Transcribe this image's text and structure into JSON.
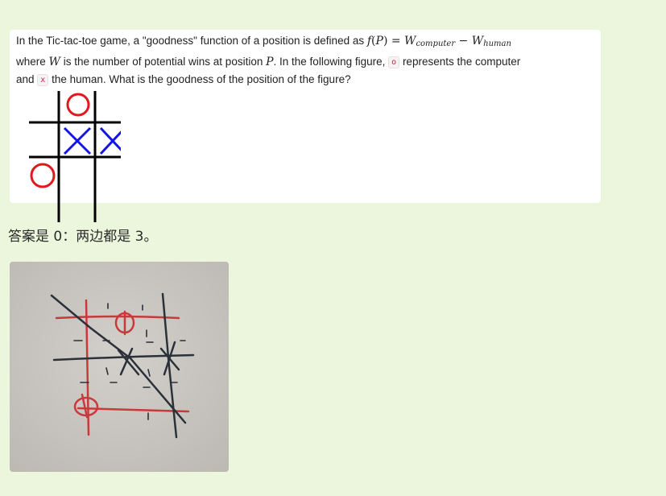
{
  "question": {
    "line1_text": "In the Tic-tac-toe game, a \"goodness\" function of a position is defined as",
    "formula": {
      "f": "f",
      "paren_open": "(",
      "P": "P",
      "paren_close": ")",
      "eq": " = ",
      "W": "W",
      "sub_computer": "computer",
      "minus": " − ",
      "sub_human": "human"
    },
    "line2_before_W": "where",
    "W_symbol": "W",
    "line2_middle": "is the number of potential wins at position",
    "P_symbol": "P",
    "line2_after_P": ". In the following figure,",
    "o_badge": "o",
    "line2_end": "represents the computer",
    "line3_and": "and",
    "x_badge": "x",
    "line3_rest": "the human. What is the goodness of the position of the figure?"
  },
  "answer": {
    "text": "答案是 0：两边都是 3。"
  },
  "colors": {
    "background": "#ecf6dc",
    "card": "#ffffff",
    "o_mark": "#e0191d",
    "x_mark": "#1515e6",
    "grid": "#000000"
  },
  "board": {
    "cells": [
      [
        "",
        "O",
        ""
      ],
      [
        "",
        "X",
        "X"
      ],
      [
        "O",
        "",
        ""
      ]
    ]
  }
}
